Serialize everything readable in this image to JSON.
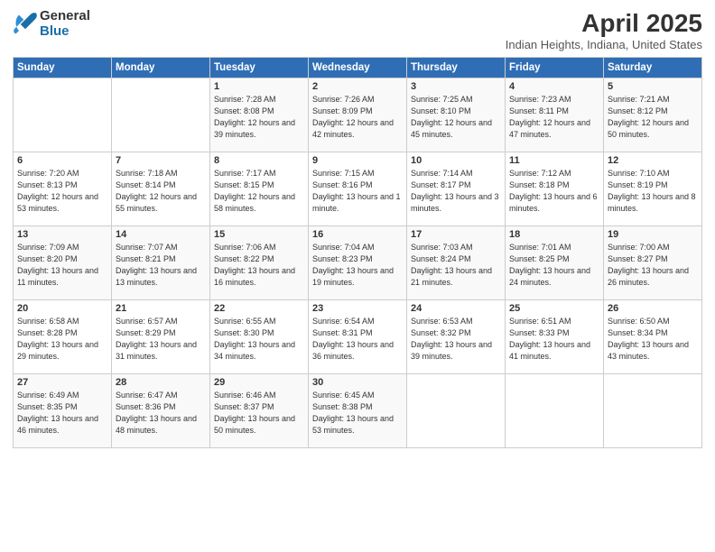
{
  "logo": {
    "general": "General",
    "blue": "Blue"
  },
  "title": "April 2025",
  "subtitle": "Indian Heights, Indiana, United States",
  "days_of_week": [
    "Sunday",
    "Monday",
    "Tuesday",
    "Wednesday",
    "Thursday",
    "Friday",
    "Saturday"
  ],
  "weeks": [
    [
      {
        "day": "",
        "info": ""
      },
      {
        "day": "",
        "info": ""
      },
      {
        "day": "1",
        "info": "Sunrise: 7:28 AM\nSunset: 8:08 PM\nDaylight: 12 hours\nand 39 minutes."
      },
      {
        "day": "2",
        "info": "Sunrise: 7:26 AM\nSunset: 8:09 PM\nDaylight: 12 hours\nand 42 minutes."
      },
      {
        "day": "3",
        "info": "Sunrise: 7:25 AM\nSunset: 8:10 PM\nDaylight: 12 hours\nand 45 minutes."
      },
      {
        "day": "4",
        "info": "Sunrise: 7:23 AM\nSunset: 8:11 PM\nDaylight: 12 hours\nand 47 minutes."
      },
      {
        "day": "5",
        "info": "Sunrise: 7:21 AM\nSunset: 8:12 PM\nDaylight: 12 hours\nand 50 minutes."
      }
    ],
    [
      {
        "day": "6",
        "info": "Sunrise: 7:20 AM\nSunset: 8:13 PM\nDaylight: 12 hours\nand 53 minutes."
      },
      {
        "day": "7",
        "info": "Sunrise: 7:18 AM\nSunset: 8:14 PM\nDaylight: 12 hours\nand 55 minutes."
      },
      {
        "day": "8",
        "info": "Sunrise: 7:17 AM\nSunset: 8:15 PM\nDaylight: 12 hours\nand 58 minutes."
      },
      {
        "day": "9",
        "info": "Sunrise: 7:15 AM\nSunset: 8:16 PM\nDaylight: 13 hours\nand 1 minute."
      },
      {
        "day": "10",
        "info": "Sunrise: 7:14 AM\nSunset: 8:17 PM\nDaylight: 13 hours\nand 3 minutes."
      },
      {
        "day": "11",
        "info": "Sunrise: 7:12 AM\nSunset: 8:18 PM\nDaylight: 13 hours\nand 6 minutes."
      },
      {
        "day": "12",
        "info": "Sunrise: 7:10 AM\nSunset: 8:19 PM\nDaylight: 13 hours\nand 8 minutes."
      }
    ],
    [
      {
        "day": "13",
        "info": "Sunrise: 7:09 AM\nSunset: 8:20 PM\nDaylight: 13 hours\nand 11 minutes."
      },
      {
        "day": "14",
        "info": "Sunrise: 7:07 AM\nSunset: 8:21 PM\nDaylight: 13 hours\nand 13 minutes."
      },
      {
        "day": "15",
        "info": "Sunrise: 7:06 AM\nSunset: 8:22 PM\nDaylight: 13 hours\nand 16 minutes."
      },
      {
        "day": "16",
        "info": "Sunrise: 7:04 AM\nSunset: 8:23 PM\nDaylight: 13 hours\nand 19 minutes."
      },
      {
        "day": "17",
        "info": "Sunrise: 7:03 AM\nSunset: 8:24 PM\nDaylight: 13 hours\nand 21 minutes."
      },
      {
        "day": "18",
        "info": "Sunrise: 7:01 AM\nSunset: 8:25 PM\nDaylight: 13 hours\nand 24 minutes."
      },
      {
        "day": "19",
        "info": "Sunrise: 7:00 AM\nSunset: 8:27 PM\nDaylight: 13 hours\nand 26 minutes."
      }
    ],
    [
      {
        "day": "20",
        "info": "Sunrise: 6:58 AM\nSunset: 8:28 PM\nDaylight: 13 hours\nand 29 minutes."
      },
      {
        "day": "21",
        "info": "Sunrise: 6:57 AM\nSunset: 8:29 PM\nDaylight: 13 hours\nand 31 minutes."
      },
      {
        "day": "22",
        "info": "Sunrise: 6:55 AM\nSunset: 8:30 PM\nDaylight: 13 hours\nand 34 minutes."
      },
      {
        "day": "23",
        "info": "Sunrise: 6:54 AM\nSunset: 8:31 PM\nDaylight: 13 hours\nand 36 minutes."
      },
      {
        "day": "24",
        "info": "Sunrise: 6:53 AM\nSunset: 8:32 PM\nDaylight: 13 hours\nand 39 minutes."
      },
      {
        "day": "25",
        "info": "Sunrise: 6:51 AM\nSunset: 8:33 PM\nDaylight: 13 hours\nand 41 minutes."
      },
      {
        "day": "26",
        "info": "Sunrise: 6:50 AM\nSunset: 8:34 PM\nDaylight: 13 hours\nand 43 minutes."
      }
    ],
    [
      {
        "day": "27",
        "info": "Sunrise: 6:49 AM\nSunset: 8:35 PM\nDaylight: 13 hours\nand 46 minutes."
      },
      {
        "day": "28",
        "info": "Sunrise: 6:47 AM\nSunset: 8:36 PM\nDaylight: 13 hours\nand 48 minutes."
      },
      {
        "day": "29",
        "info": "Sunrise: 6:46 AM\nSunset: 8:37 PM\nDaylight: 13 hours\nand 50 minutes."
      },
      {
        "day": "30",
        "info": "Sunrise: 6:45 AM\nSunset: 8:38 PM\nDaylight: 13 hours\nand 53 minutes."
      },
      {
        "day": "",
        "info": ""
      },
      {
        "day": "",
        "info": ""
      },
      {
        "day": "",
        "info": ""
      }
    ]
  ]
}
